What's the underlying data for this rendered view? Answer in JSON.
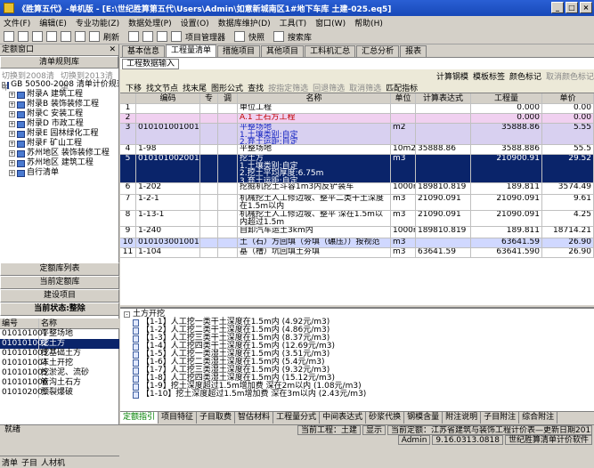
{
  "window": {
    "title": "《胜算五代》-单机版 - [E:\\世纪胜算第五代\\Users\\Admin\\如意新城南区1#地下车库 土建-025.eq5]"
  },
  "menu": [
    "文件(F)",
    "编辑(E)",
    "专业功能(Z)",
    "数据处理(P)",
    "设置(O)",
    "数据库维护(D)",
    "工具(T)",
    "窗口(W)",
    "帮助(H)"
  ],
  "toolbar": {
    "refresh": "刷新",
    "project_manager": "项目管理器",
    "snapshot": "快照",
    "search": "搜索库"
  },
  "left": {
    "header": "定额窗口",
    "close": "✕",
    "library_button": "清单规则库",
    "switch_2008": "切换到2008清单",
    "switch_2013": "切换到2013清单",
    "tree_root": "GB 50500-2008 清单计价规范",
    "tree": [
      "附录A 建筑工程",
      "附录B 装饰装修工程",
      "附录C 安装工程",
      "附录D 市政工程",
      "附录E 园林绿化工程",
      "附录F 矿山工程",
      "苏州地区 装饰装修工程",
      "苏州地区 建筑工程",
      "自行清单"
    ],
    "quota_list": "定额库列表",
    "current_quota": "当前定额库",
    "build_project": "建设项目",
    "status_header": "当前状态:整除",
    "table_head": [
      "编号",
      "名称"
    ],
    "rows": [
      [
        "010101001",
        "平整场地"
      ],
      [
        "010101002",
        "挖土方"
      ],
      [
        "010101003",
        "挖基础土方"
      ],
      [
        "010101004",
        "冻土开挖"
      ],
      [
        "010101005",
        "挖淤泥、流砂"
      ],
      [
        "010101006",
        "管沟土石方"
      ],
      [
        "010102001",
        "预裂爆破"
      ]
    ],
    "tabs": [
      "清单",
      "子目",
      "人材机"
    ]
  },
  "main": {
    "tabs": [
      "基本信息",
      "工程量清单",
      "措施项目",
      "其他项目",
      "工料机汇总",
      "汇总分析",
      "报表"
    ],
    "active_tab": "工程量清单",
    "subtab": "工程数据输入",
    "tb2": [
      "计算钢模",
      "模板标签",
      "颜色标记",
      "取消颜色标记"
    ],
    "tb3": [
      "下移",
      "找文节点",
      "找末尾",
      "图形公式",
      "查找",
      "按指定筛选",
      "回退筛选",
      "取消筛选",
      "匹配指标"
    ],
    "columns": [
      "",
      "编码",
      "专业",
      "调整",
      "名称",
      "单位",
      "计算表达式",
      "工程量",
      "单价"
    ],
    "rows": [
      {
        "code": "",
        "name": "单位工程",
        "unit": "",
        "expr": "",
        "qty": "0.000",
        "price": "0.00",
        "cls": ""
      },
      {
        "code": "",
        "name": "A.1 土石方工程",
        "unit": "",
        "expr": "",
        "qty": "0.000",
        "price": "0.00",
        "cls": "pink"
      },
      {
        "code": "010101001001",
        "name": "平整场地\n1.土壤类别:自定\n2.弃土运距:自定",
        "unit": "m2",
        "expr": "",
        "qty": "35888.86",
        "price": "5.55",
        "cls": "lav"
      },
      {
        "code": "1-98",
        "name": "平整场地",
        "unit": "10m2",
        "expr": "35888.86",
        "qty": "3588.886",
        "price": "55.5",
        "cls": ""
      },
      {
        "code": "010101002001",
        "name": "挖土方\n1.土壤类别:自定\n2.挖土平均厚度:6.75m\n3.弃土运距:自定",
        "unit": "m3",
        "expr": "",
        "qty": "210900.91",
        "price": "29.52",
        "cls": "hl"
      },
      {
        "code": "1-202",
        "name": "挖掘机挖土斗容1m3内反铲装车",
        "unit": "1000m3",
        "expr": "189810.819",
        "qty": "189.811",
        "price": "3574.49",
        "cls": ""
      },
      {
        "code": "1-2-1",
        "name": "机械挖土人工修边坡、整平二类干土深度在1.5m以内",
        "unit": "m3",
        "expr": "21090.091",
        "qty": "21090.091",
        "price": "9.61",
        "cls": ""
      },
      {
        "code": "1-13-1",
        "name": "机械挖土人工修边坡、整平 深在1.5m以内超过1.5m",
        "unit": "m3",
        "expr": "21090.091",
        "qty": "21090.091",
        "price": "4.25",
        "cls": ""
      },
      {
        "code": "1-240",
        "name": "自卸汽车运土3km内",
        "unit": "1000m3",
        "expr": "189810.819",
        "qty": "189.811",
        "price": "18714.21",
        "cls": ""
      },
      {
        "code": "010103001001",
        "name": "土（石）方回填（夯填（碾压））按视范",
        "unit": "m3",
        "expr": "",
        "qty": "63641.59",
        "price": "26.90",
        "cls": "blue"
      },
      {
        "code": "1-104",
        "name": "基（槽）坑回填土夯填",
        "unit": "m3",
        "expr": "63641.59",
        "qty": "63641.590",
        "price": "26.90",
        "cls": ""
      }
    ],
    "bottom_title": "土方开挖",
    "bottom_items": [
      "【1-1】人工挖一类干土深度在1.5m内 (4.92元/m3)",
      "【1-2】人工挖二类干土深度在1.5m内 (4.86元/m3)",
      "【1-3】人工挖三类干土深度在1.5m内 (8.37元/m3)",
      "【1-4】人工挖四类干土深度在1.5m内 (12.69元/m3)",
      "【1-5】人工挖一类湿土深度在1.5m内 (3.51元/m3)",
      "【1-6】人工挖二类湿土深度在1.5m内 (5.4元/m3)",
      "【1-7】人工挖三类湿土深度在1.5m内 (9.32元/m3)",
      "【1-8】人工挖四类湿土深度在1.5m内 (15.12元/m3)",
      "【1-9】挖土深度超过1.5m增加费 深在2m以内 (1.08元/m3)",
      "【1-10】挖土深度超过1.5m增加费 深在3m以内 (2.43元/m3)"
    ],
    "bottom_tabs": [
      "定额指引",
      "项目特征",
      "子目取费",
      "智估材料",
      "工程量分式",
      "中间表达式",
      "砂浆代换",
      "钢模含量",
      "附注说明",
      "子目附注",
      "综合附注"
    ]
  },
  "status": {
    "left": "就绪",
    "cur_project": "当前工程：土建",
    "display": "显示",
    "cur_quota": "当前定额：江苏省建筑与装饰工程计价表—更新日期2012-01-01",
    "user": "Admin",
    "version": "9.16.0313.0818",
    "company": "世纪胜算清单计价软件"
  }
}
